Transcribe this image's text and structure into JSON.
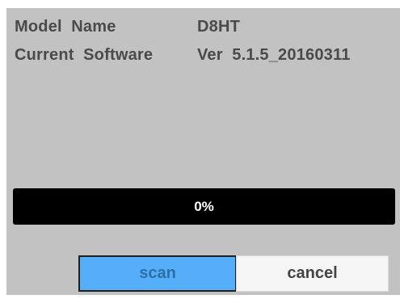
{
  "info": {
    "model_label": "Model  Name",
    "model_value": "D8HT",
    "software_label": "Current  Software",
    "software_value": "Ver  5.1.5_20160311"
  },
  "progress": {
    "percent": 0,
    "text": "0%"
  },
  "buttons": {
    "scan_label": "scan",
    "cancel_label": "cancel"
  },
  "colors": {
    "panel_bg": "#c2c2c2",
    "progress_bg": "#000000",
    "selected_button": "#56aef8",
    "text": "#4a4a4a"
  }
}
